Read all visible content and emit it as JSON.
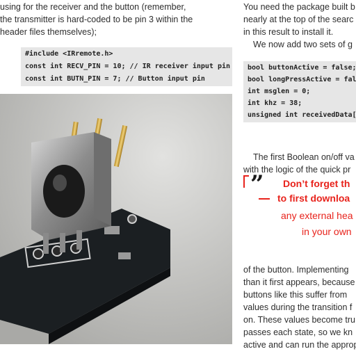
{
  "left_column": {
    "intro_lines": [
      "using for the receiver and the button (remember,",
      "the transmitter is hard-coded to be pin 3 within the",
      "header files themselves);"
    ],
    "code_lines": [
      "#include <IRremote.h>",
      "const int RECV_PIN = 10; // IR receiver input pin",
      "const int BUTN_PIN = 7; // Button input pin"
    ]
  },
  "right_column": {
    "top_lines": [
      "You need the package built b",
      "nearly at the top of the searc",
      "in this result to install it.",
      "We now add two sets of g"
    ],
    "code_lines": [
      "bool buttonActive = false;",
      "bool longPressActive = fals",
      "int msglen = 0;",
      "int khz = 38;",
      "unsigned int receivedData[R"
    ],
    "middle_lines": [
      "The first Boolean on/off va",
      "with the logic of the quick pr"
    ],
    "pull_quote": {
      "mark": "”",
      "line1": "Don’t forget th",
      "line2": "to first downloa",
      "line3": "any external hea",
      "line4": "in your own"
    },
    "bottom_lines": [
      "of the button. Implementing",
      "than it first appears, because",
      "buttons like this suffer from",
      "values during the transition f",
      "on. These values become tru",
      "passes each state, so we kn",
      "active and can run the approp"
    ]
  },
  "colors": {
    "accent_red": "#e8231c",
    "code_bg": "#e6e6e6",
    "text": "#2e2e2e"
  }
}
